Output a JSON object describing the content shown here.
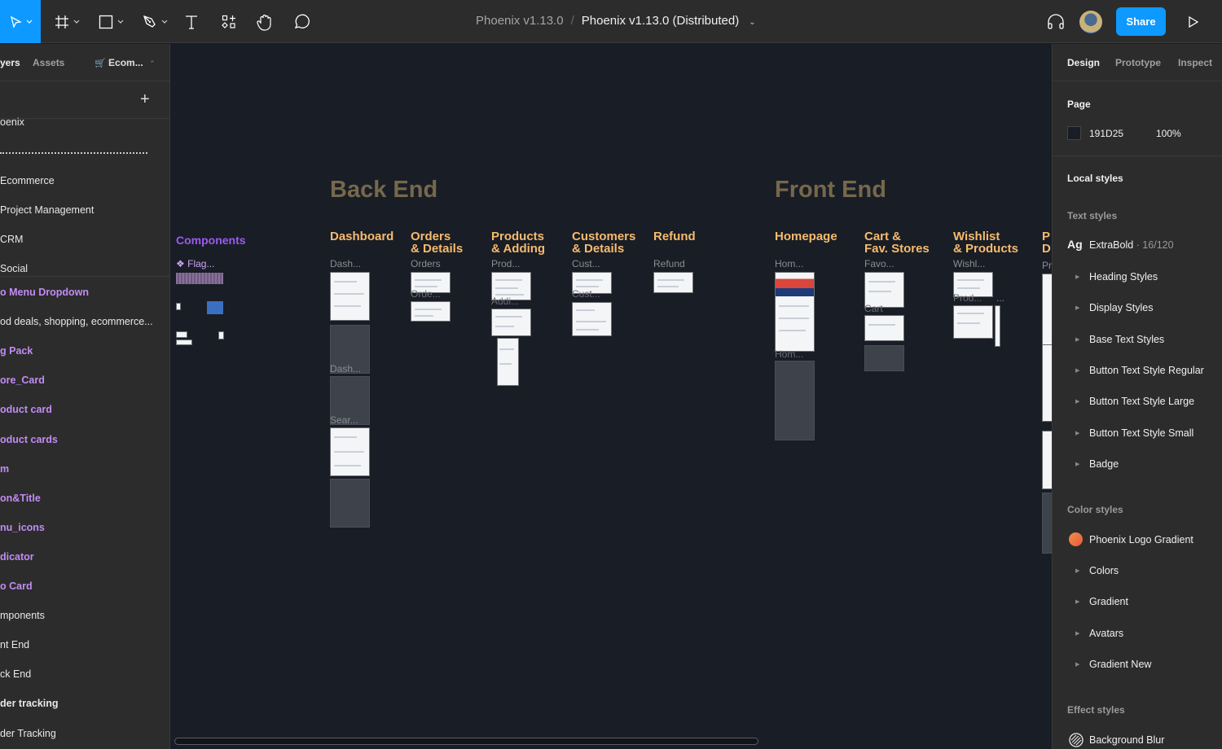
{
  "toolbar": {
    "tools": [
      {
        "name": "move-tool",
        "icon": "cursor-icon",
        "active": true,
        "has_dropdown": true
      },
      {
        "name": "frame-tool",
        "icon": "frame-icon",
        "has_dropdown": true
      },
      {
        "name": "shape-tool",
        "icon": "rectangle-icon",
        "has_dropdown": true
      },
      {
        "name": "pen-tool",
        "icon": "pen-icon",
        "has_dropdown": true
      },
      {
        "name": "text-tool",
        "icon": "text-icon"
      },
      {
        "name": "resources-tool",
        "icon": "components-icon"
      },
      {
        "name": "hand-tool",
        "icon": "hand-icon"
      },
      {
        "name": "comment-tool",
        "icon": "comment-icon"
      }
    ],
    "breadcrumb_project": "Phoenix v1.13.0",
    "breadcrumb_separator": "/",
    "file_name": "Phoenix v1.13.0 (Distributed)",
    "share_label": "Share",
    "accent_color": "#0D99FF"
  },
  "left_panel": {
    "tabs": [
      "yers",
      "Assets"
    ],
    "page_selector": "Ecom...",
    "page_selector_icon": "cart-icon",
    "pages": [
      "oenix",
      "Ecommerce",
      "Project Management",
      "CRM",
      "Social"
    ],
    "layers": [
      {
        "label": "o Menu Dropdown",
        "style": "purple"
      },
      {
        "label": "od deals, shopping, ecommerce...",
        "style": "normal"
      },
      {
        "label": "g Pack",
        "style": "purple"
      },
      {
        "label": "ore_Card",
        "style": "purple"
      },
      {
        "label": "oduct card",
        "style": "purple"
      },
      {
        "label": "oduct cards",
        "style": "purple"
      },
      {
        "label": "m",
        "style": "purple"
      },
      {
        "label": "on&Title",
        "style": "purple"
      },
      {
        "label": "nu_icons",
        "style": "purple"
      },
      {
        "label": "dicator",
        "style": "purple"
      },
      {
        "label": "o Card",
        "style": "purple"
      },
      {
        "label": "mponents",
        "style": "normal"
      },
      {
        "label": "nt End",
        "style": "normal"
      },
      {
        "label": "ck End",
        "style": "normal"
      },
      {
        "label": "der tracking",
        "style": "bold"
      },
      {
        "label": "der Tracking",
        "style": "normal"
      }
    ]
  },
  "canvas": {
    "background": "#191D25",
    "components": {
      "title": "Components",
      "flag_label": "Flag..."
    },
    "sections": [
      {
        "title": "Back End",
        "columns": [
          {
            "title": "Dashboard",
            "frames": [
              "Dash...",
              "Dash...",
              "Sear..."
            ]
          },
          {
            "title": "Orders\n& Details",
            "frames": [
              "Orders",
              "Orde..."
            ]
          },
          {
            "title": "Products\n& Adding",
            "frames": [
              "Prod...",
              "Addi..."
            ]
          },
          {
            "title": "Customers\n& Details",
            "frames": [
              "Cust...",
              "Cust..."
            ]
          },
          {
            "title": "Refund",
            "frames": [
              "Refund"
            ]
          }
        ]
      },
      {
        "title": "Front End",
        "columns": [
          {
            "title": "Homepage",
            "frames": [
              "Hom...",
              "Hom..."
            ]
          },
          {
            "title": "Cart &\nFav. Stores",
            "frames": [
              "Favo...",
              "Cart"
            ]
          },
          {
            "title": "Wishlist\n& Products",
            "frames": [
              "Wishl...",
              "Prod...",
              "..."
            ]
          },
          {
            "title": "P\nD",
            "frames": [
              "Pr"
            ]
          }
        ]
      }
    ]
  },
  "right_panel": {
    "tabs": [
      "Design",
      "Prototype",
      "Inspect"
    ],
    "active_tab": "Design",
    "page": {
      "heading": "Page",
      "color_hex": "191D25",
      "opacity": "100%",
      "swatch": "#191D25"
    },
    "local_styles_heading": "Local styles",
    "text_styles": {
      "heading": "Text styles",
      "first": {
        "prefix": "Ag",
        "name": "ExtraBold",
        "meta": " · 16/120"
      },
      "groups": [
        "Heading Styles",
        "Display Styles",
        "Base Text Styles",
        "Button Text Style Regular",
        "Button Text Style Large",
        "Button Text Style Small",
        "Badge"
      ]
    },
    "color_styles": {
      "heading": "Color styles",
      "first": {
        "name": "Phoenix Logo Gradient",
        "swatch": "#F0703A"
      },
      "groups": [
        "Colors",
        "Gradient",
        "Avatars",
        "Gradient New"
      ]
    },
    "effect_styles": {
      "heading": "Effect styles",
      "first": {
        "name": "Background Blur"
      }
    }
  }
}
